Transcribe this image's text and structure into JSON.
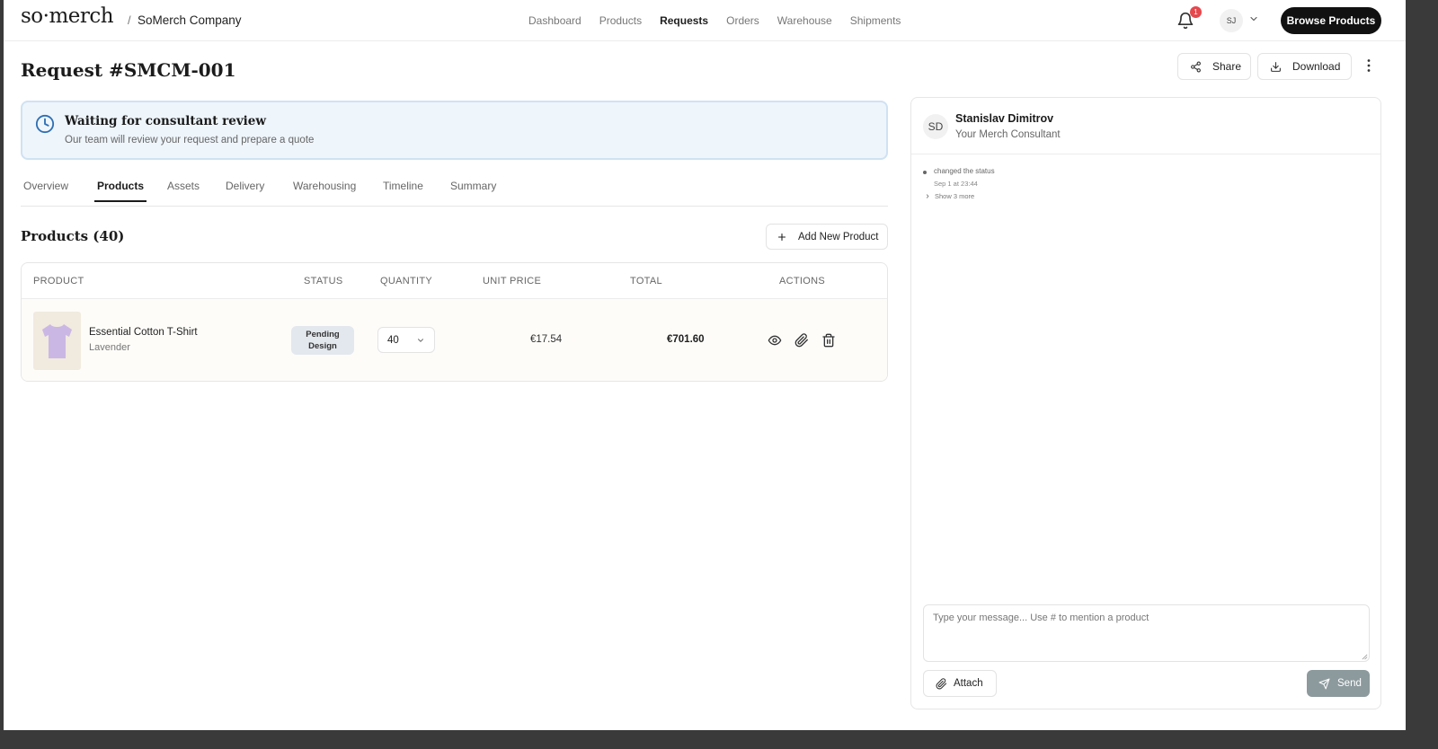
{
  "brand": {
    "logo": "so·merch",
    "separator": "/",
    "company": "SoMerch Company"
  },
  "nav": {
    "items": [
      "Dashboard",
      "Products",
      "Requests",
      "Orders",
      "Warehouse",
      "Shipments"
    ],
    "active": "Requests"
  },
  "notifications": {
    "count": "1"
  },
  "user": {
    "initials": "SJ"
  },
  "header": {
    "browse_label": "Browse Products",
    "title": "Request #SMCM-001",
    "share_label": "Share",
    "download_label": "Download"
  },
  "banner": {
    "title": "Waiting for consultant review",
    "subtitle": "Our team will review your request and prepare a quote"
  },
  "tabs": [
    "Overview",
    "Products",
    "Assets",
    "Delivery",
    "Warehousing",
    "Timeline",
    "Summary"
  ],
  "active_tab": "Products",
  "products": {
    "title": "Products (40)",
    "add_label": "Add New Product",
    "columns": [
      "PRODUCT",
      "STATUS",
      "QUANTITY",
      "UNIT PRICE",
      "TOTAL",
      "ACTIONS"
    ],
    "rows": [
      {
        "name": "Essential Cotton T-Shirt",
        "variant": "Lavender",
        "status_line1": "Pending",
        "status_line2": "Design",
        "quantity": "40",
        "unit_price": "€17.54",
        "total": "€701.60"
      }
    ]
  },
  "consultant": {
    "initials": "SD",
    "name": "Stanislav Dimitrov",
    "role": "Your Merch Consultant",
    "activity": {
      "text": "changed the status",
      "time": "Sep 1 at 23:44",
      "show_more": "Show 3 more"
    },
    "message_placeholder": "Type your message... Use # to mention a product",
    "attach_label": "Attach",
    "send_label": "Send"
  },
  "colors": {
    "primary": "#111111",
    "banner_bg": "#eef5fb",
    "banner_border": "#cfe2f3",
    "banner_icon": "#2f6fb3",
    "badge": "#e5484d",
    "send_bg": "#8c999d",
    "tshirt": "#cbb7e4"
  }
}
